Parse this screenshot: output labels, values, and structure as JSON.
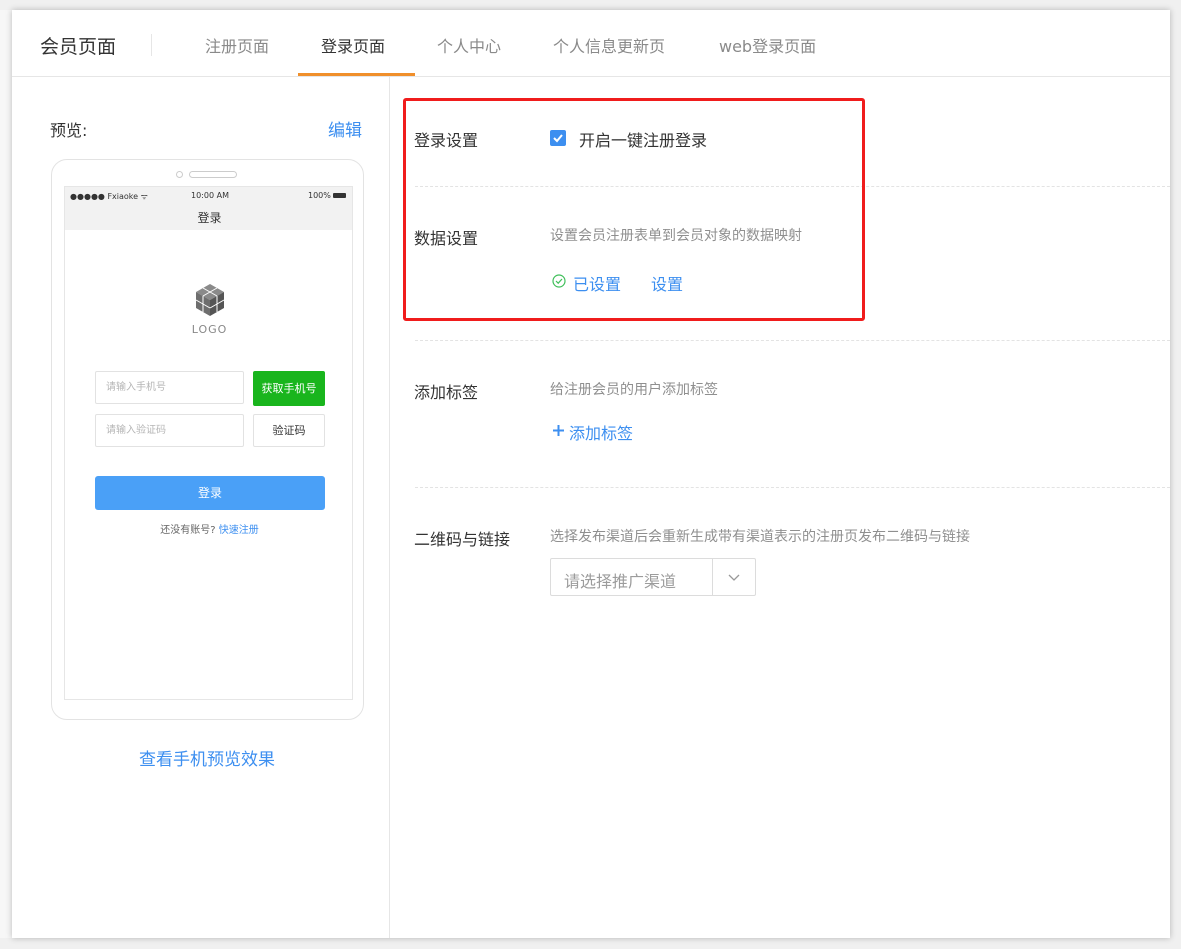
{
  "header": {
    "title": "会员页面",
    "tabs": [
      {
        "label": "注册页面",
        "active": false
      },
      {
        "label": "登录页面",
        "active": true
      },
      {
        "label": "个人中心",
        "active": false
      },
      {
        "label": "个人信息更新页",
        "active": false
      },
      {
        "label": "web登录页面",
        "active": false
      }
    ]
  },
  "preview": {
    "label": "预览:",
    "edit_label": "编辑",
    "mobile_preview_link": "查看手机预览效果",
    "phone": {
      "status_bar": {
        "carrier": "●●●●● Fxiaoke ᯤ",
        "time": "10:00 AM",
        "battery": "100%"
      },
      "screen_title": "登录",
      "logo_text": "LOGO",
      "phone_placeholder": "请输入手机号",
      "get_phone_button": "获取手机号",
      "code_placeholder": "请输入验证码",
      "code_button": "验证码",
      "login_button": "登录",
      "no_account_text": "还没有账号?",
      "quick_register_link": "快速注册"
    }
  },
  "settings": {
    "login": {
      "label": "登录设置",
      "checkbox_label": "开启一键注册登录",
      "checked": true
    },
    "data": {
      "label": "数据设置",
      "description": "设置会员注册表单到会员对象的数据映射",
      "status_text": "已设置",
      "setup_link": "设置"
    },
    "tags": {
      "label": "添加标签",
      "description": "给注册会员的用户添加标签",
      "add_link": "添加标签"
    },
    "qrcode": {
      "label": "二维码与链接",
      "description": "选择发布渠道后会重新生成带有渠道表示的注册页发布二维码与链接",
      "select_placeholder": "请选择推广渠道"
    }
  },
  "colors": {
    "accent": "#3d8ff0",
    "tab_underline": "#f08f2b",
    "green_button": "#19b51d",
    "login_button": "#4aa0f7",
    "highlight": "#f01c1c"
  }
}
